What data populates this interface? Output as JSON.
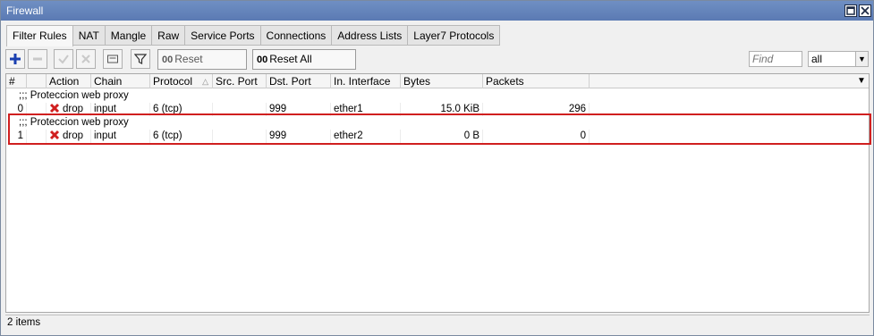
{
  "window": {
    "title": "Firewall"
  },
  "tabs": [
    {
      "label": "Filter Rules",
      "active": true
    },
    {
      "label": "NAT"
    },
    {
      "label": "Mangle"
    },
    {
      "label": "Raw"
    },
    {
      "label": "Service Ports"
    },
    {
      "label": "Connections"
    },
    {
      "label": "Address Lists"
    },
    {
      "label": "Layer7 Protocols"
    }
  ],
  "toolbar": {
    "add_icon": "plus-icon",
    "remove_icon": "minus-icon",
    "enable_icon": "check-icon",
    "disable_icon": "x-icon",
    "comment_icon": "note-icon",
    "filter_icon": "funnel-icon",
    "reset_counters": {
      "prefix": "00",
      "label": "Reset Counters"
    },
    "reset_all_counters": {
      "prefix": "00",
      "label": "Reset All Counters"
    },
    "find_placeholder": "Find",
    "filter_select_value": "all"
  },
  "table": {
    "columns": [
      "#",
      "Action",
      "Chain",
      "Protocol",
      "Src. Port",
      "Dst. Port",
      "In. Interface",
      "Bytes",
      "Packets"
    ],
    "rows": [
      {
        "comment": ";;; Proteccion web proxy",
        "index": "0",
        "action": "drop",
        "chain": "input",
        "protocol": "6 (tcp)",
        "src_port": "",
        "dst_port": "999",
        "in_interface": "ether1",
        "bytes": "15.0 KiB",
        "packets": "296"
      },
      {
        "comment": ";;; Proteccion web proxy",
        "index": "1",
        "action": "drop",
        "chain": "input",
        "protocol": "6 (tcp)",
        "src_port": "",
        "dst_port": "999",
        "in_interface": "ether2",
        "bytes": "0 B",
        "packets": "0",
        "highlighted": true
      }
    ]
  },
  "status": {
    "items_count": "2 items"
  },
  "colors": {
    "titlebar": "#6f8fc3",
    "highlight_border": "#d01f1f",
    "drop_icon": "#d01f1f",
    "add_icon": "#1a3fb0"
  }
}
